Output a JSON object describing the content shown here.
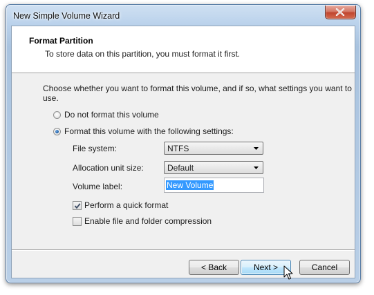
{
  "window": {
    "title": "New Simple Volume Wizard"
  },
  "header": {
    "title": "Format Partition",
    "subtitle": "To store data on this partition, you must format it first."
  },
  "instruction": "Choose whether you want to format this volume, and if so, what settings you want to use.",
  "options": {
    "no_format": {
      "label": "Do not format this volume",
      "selected": false
    },
    "format": {
      "label": "Format this volume with the following settings:",
      "selected": true
    }
  },
  "settings": {
    "file_system": {
      "label": "File system:",
      "value": "NTFS"
    },
    "allocation_unit": {
      "label": "Allocation unit size:",
      "value": "Default"
    },
    "volume_label": {
      "label": "Volume label:",
      "value": "New Volume"
    }
  },
  "checks": {
    "quick_format": {
      "label": "Perform a quick format",
      "checked": true
    },
    "compression": {
      "label": "Enable file and folder compression",
      "checked": false
    }
  },
  "buttons": {
    "back": "< Back",
    "next": "Next >",
    "cancel": "Cancel"
  },
  "icons": {
    "close": "close-icon",
    "dropdown": "chevron-down-icon",
    "check": "checkmark-icon",
    "cursor": "mouse-pointer-icon"
  }
}
